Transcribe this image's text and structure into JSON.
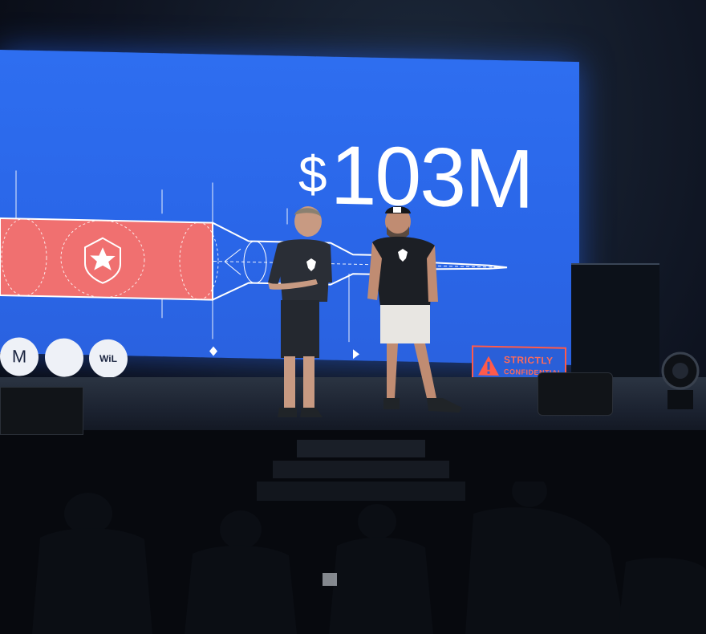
{
  "slide": {
    "currency": "$",
    "amount": "103M",
    "investors": [
      "M",
      "WiL"
    ],
    "badge_line1": "STRICTLY",
    "badge_line2": "CONFIDENTIAL",
    "warning_icon": "warning-triangle-icon",
    "shield_icon": "star-shield-icon"
  },
  "colors": {
    "screen_blue": "#2e6ef0",
    "rocket_red": "#f07070",
    "badge_red": "#ff5a4a"
  }
}
